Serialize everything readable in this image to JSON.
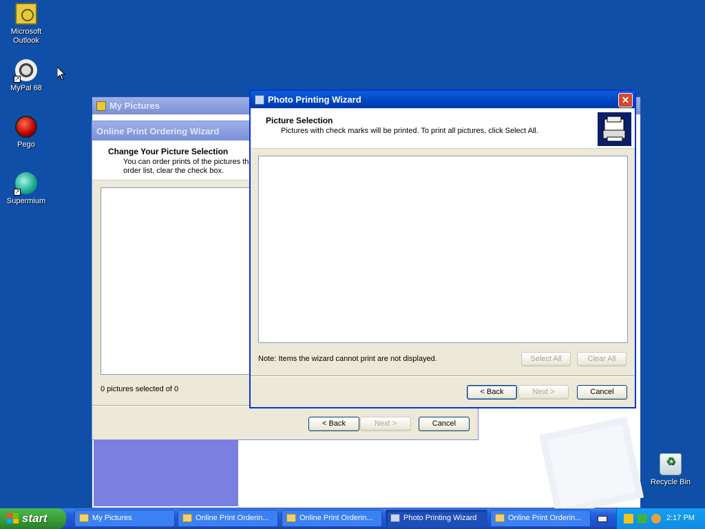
{
  "desktop": {
    "icons": [
      {
        "label": "Microsoft Outlook"
      },
      {
        "label": "MyPal 68"
      },
      {
        "label": "Pego"
      },
      {
        "label": "Supermium"
      },
      {
        "label": "Recycle Bin"
      }
    ]
  },
  "back_window": {
    "title": "My Pictures",
    "wizard_title": "Online Print Ordering Wizard",
    "heading": "Change Your Picture Selection",
    "description_line1": "You can order prints of the pictures tha",
    "description_line2": "order list, clear the check box.",
    "status": "0 pictures selected of 0",
    "back_label": "< Back",
    "next_label": "Next >",
    "cancel_label": "Cancel"
  },
  "front_window": {
    "title": "Photo Printing Wizard",
    "close_label": "✕",
    "heading": "Picture Selection",
    "description": "Pictures with check marks will be printed.  To print all pictures, click Select All.",
    "note": "Note: Items the wizard cannot print are not displayed.",
    "select_all_label": "Select All",
    "clear_all_label": "Clear All",
    "back_label": "< Back",
    "next_label": "Next >",
    "cancel_label": "Cancel"
  },
  "taskbar": {
    "start_label": "start",
    "tasks": [
      {
        "label": "My Pictures"
      },
      {
        "label": "Online Print Orderin..."
      },
      {
        "label": "Online Print Orderin..."
      },
      {
        "label": "Photo Printing Wizard"
      },
      {
        "label": "Online Print Orderin..."
      }
    ],
    "clock": "2:17 PM"
  }
}
